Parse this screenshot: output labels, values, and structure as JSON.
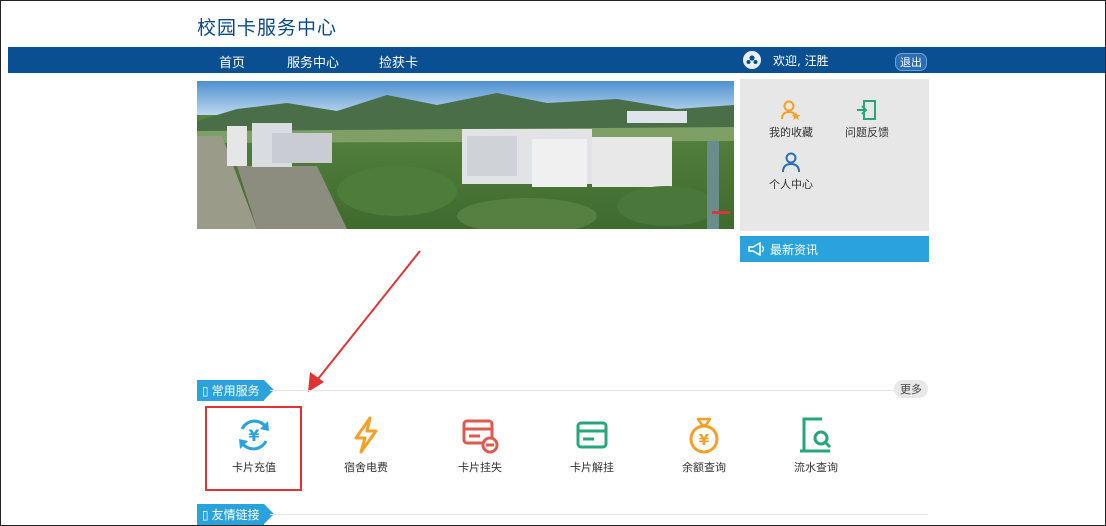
{
  "site": {
    "title": "校园卡服务中心"
  },
  "nav": {
    "items": [
      "首页",
      "服务中心",
      "捡获卡"
    ]
  },
  "user": {
    "welcome": "欢迎, 汪胜",
    "logout": "退出"
  },
  "quick_links": [
    {
      "label": "我的收藏",
      "icon": "user-star-icon"
    },
    {
      "label": "问题反馈",
      "icon": "door-exit-icon"
    },
    {
      "label": "个人中心",
      "icon": "person-icon"
    }
  ],
  "news": {
    "title": "最新资讯",
    "icon": "megaphone-icon"
  },
  "common_services": {
    "title": "常用服务",
    "more": "更多",
    "items": [
      {
        "label": "卡片充值",
        "icon": "yuan-refresh-icon",
        "color": "#2aa3dd"
      },
      {
        "label": "宿舍电费",
        "icon": "lightning-icon",
        "color": "#f3a02b"
      },
      {
        "label": "卡片挂失",
        "icon": "card-lock-icon",
        "color": "#e0594f"
      },
      {
        "label": "卡片解挂",
        "icon": "card-icon",
        "color": "#27a67a"
      },
      {
        "label": "余额查询",
        "icon": "money-bag-icon",
        "color": "#f3a02b"
      },
      {
        "label": "流水查询",
        "icon": "doc-search-icon",
        "color": "#27a67a"
      }
    ]
  },
  "friend_links": {
    "title": "友情链接"
  },
  "colors": {
    "nav": "#0b4f93",
    "accent": "#2aa3dd",
    "highlight": "#e03434"
  }
}
